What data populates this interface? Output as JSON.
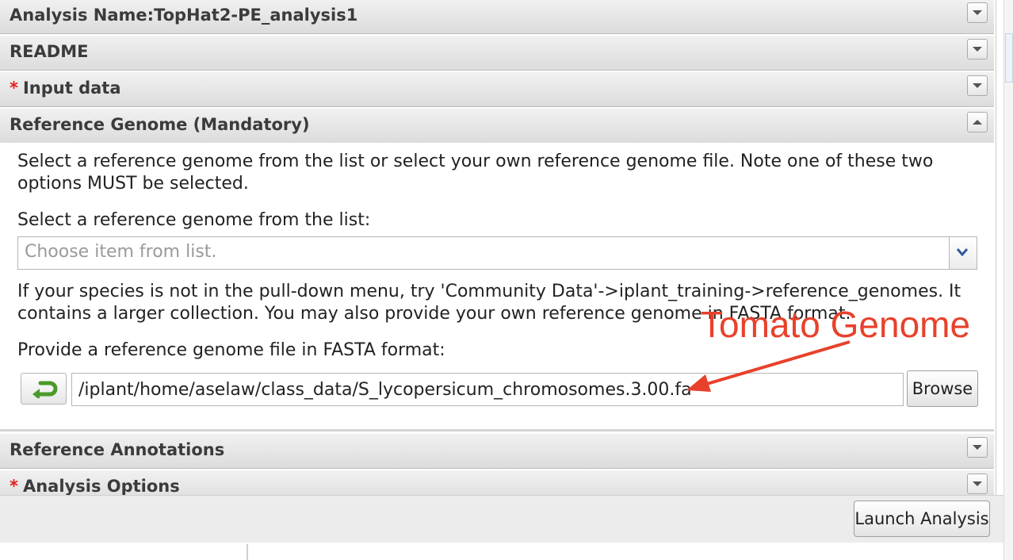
{
  "sections": {
    "analysis_name": "Analysis Name:TopHat2-PE_analysis1",
    "readme": "README",
    "input_data": "Input data",
    "input_data_required_mark": "*",
    "reference_genome": "Reference Genome (Mandatory)",
    "reference_annotations": "Reference Annotations",
    "analysis_options": "Analysis Options",
    "analysis_options_required_mark": "*"
  },
  "reference_genome_panel": {
    "intro": "Select a reference genome from the list or select your own reference genome file. Note one of these two options MUST be selected.",
    "list_label": "Select a reference genome from the list:",
    "select_placeholder": "Choose item from list.",
    "help_text": "If your species is not in the pull-down menu, try 'Community Data'->iplant_training->reference_genomes. It contains a larger collection. You may also provide your own reference genome in FASTA format.",
    "file_label": "Provide a reference genome file in FASTA format:",
    "file_path": "/iplant/home/aselaw/class_data/S_lycopersicum_chromosomes.3.00.fa",
    "browse_label": "Browse"
  },
  "annotation": {
    "label": "Tomato Genome",
    "color": "#e8412b"
  },
  "footer": {
    "launch_label": "Launch Analysis"
  },
  "icons": {
    "collapse": "chevron-down-icon",
    "expand": "chevron-up-icon",
    "reset": "reset-arrow-icon"
  }
}
